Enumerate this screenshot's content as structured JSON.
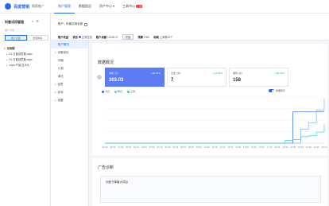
{
  "header": {
    "logo": "百度营销",
    "logo_sub": "搜索推广",
    "nav": [
      {
        "label": "账户管理",
        "active": true
      },
      {
        "label": "数据报告",
        "active": false
      },
      {
        "label": "资产中心 ▾",
        "active": false
      },
      {
        "label": "工具中心",
        "badge": "上新",
        "active": false
      }
    ]
  },
  "sidebar": {
    "title": "科普试用管理",
    "subtitle": "推广计划",
    "tabs": [
      "账户全部",
      "搜索排名"
    ],
    "tree": [
      {
        "label": "试用期",
        "level": "root"
      },
      {
        "label": "01-万能创意推.ocpc",
        "level": "child"
      },
      {
        "label": "01-万能创意推.ocpc",
        "level": "child"
      },
      {
        "label": "ocpc-产品-拉大片",
        "level": "child"
      }
    ]
  },
  "main": {
    "breadcrumb": "账户 - 科普试用全部",
    "info": {
      "account_label": "账户权益",
      "status_label": "状态",
      "status_value": "正常在投",
      "balance_label": "账户余额",
      "balance_value": "10238.47",
      "recharge_btn": "充值",
      "budget_label": "预算",
      "budget_value": "1300",
      "region_label": "地域",
      "region_value": "上海等42个"
    }
  },
  "subnav": [
    {
      "label": "账户概况",
      "type": "item",
      "active": true
    },
    {
      "label": "诊断优化",
      "type": "group",
      "active": false
    },
    {
      "label": "词组",
      "type": "item",
      "active": false
    },
    {
      "label": "计划",
      "type": "item",
      "active": false
    },
    {
      "label": "单元",
      "type": "item",
      "active": false
    },
    {
      "label": "创意",
      "type": "group",
      "active": false
    },
    {
      "label": "定向",
      "type": "group",
      "active": false
    },
    {
      "label": "设置",
      "type": "group",
      "active": false
    }
  ],
  "overview": {
    "title": "数据概况",
    "metrics": [
      {
        "label": "消费 (元)",
        "change": "+10.47%",
        "value": "303.03",
        "active": true
      },
      {
        "label": "点击 (次)",
        "change": "+12.69%",
        "value": "7",
        "active": false
      },
      {
        "label": "展现 (次)",
        "change": "+48.41%",
        "value": "158",
        "active": false
      }
    ],
    "legend": [
      {
        "label": "今日",
        "color": "#2468f2"
      },
      {
        "label": "昨日",
        "color": "#7fb8e8"
      },
      {
        "label": "上周",
        "color": "#36cfc9"
      }
    ],
    "toggle_label": "重要警示"
  },
  "chart_data": {
    "type": "line",
    "x": [
      "00:00",
      "00:49",
      "01:39",
      "02:29",
      "03:19",
      "04:09",
      "04:59",
      "05:49",
      "06:39",
      "07:29",
      "08:19",
      "09:09",
      "09:59",
      "10:49",
      "11:39",
      "12:29",
      "13:19",
      "14:09",
      "14:59",
      "15:49",
      "16:39",
      "17:29",
      "18:19",
      "19:09",
      "19:59",
      "20:49",
      "21:39",
      "22:29",
      "23:19"
    ],
    "series": [
      {
        "name": "今日",
        "color": "#2468f2",
        "values": [
          0,
          0,
          0,
          0,
          0,
          0,
          0,
          0,
          0,
          0,
          0,
          0,
          0,
          0,
          0,
          0,
          0,
          0,
          0,
          0,
          0,
          0,
          0,
          0,
          34,
          34,
          34,
          34,
          34
        ]
      },
      {
        "name": "昨日",
        "color": "#7fb8e8",
        "values": [
          0,
          0,
          0,
          0,
          0,
          0,
          0,
          0,
          0,
          0,
          0,
          0,
          0,
          0,
          0,
          0,
          0,
          0,
          0,
          0,
          0,
          0,
          0,
          0,
          0,
          15,
          22,
          36,
          48
        ]
      },
      {
        "name": "上周",
        "color": "#36cfc9",
        "values": [
          0,
          0,
          0,
          0,
          0,
          0,
          0,
          0,
          0,
          0,
          0,
          0,
          0,
          0,
          0,
          0,
          0,
          0,
          0,
          0,
          0,
          0,
          0,
          3,
          4,
          7,
          8,
          12,
          20
        ]
      }
    ],
    "ylim": [
      0,
      50
    ],
    "grid": true
  },
  "distribution": {
    "title": "广告诊断",
    "sub": "诊断下降最大项目"
  }
}
